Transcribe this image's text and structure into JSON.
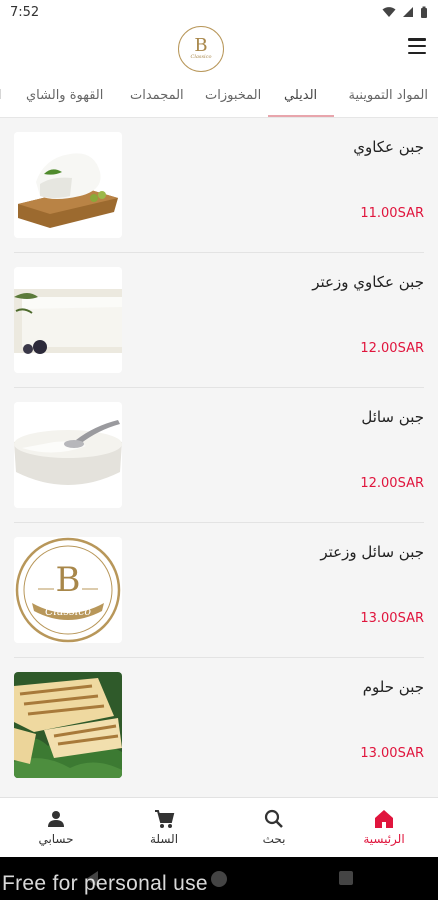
{
  "status_bar": {
    "time": "7:52"
  },
  "header": {
    "logo_main": "B",
    "logo_sub": "Classico"
  },
  "tabs": [
    {
      "label": "المواد التموينية"
    },
    {
      "label": "الديلي"
    },
    {
      "label": "المخبوزات"
    },
    {
      "label": "المجمدات"
    },
    {
      "label": "القهوة والشاي"
    }
  ],
  "active_tab": "الديلي",
  "products": [
    {
      "name": "جبن عكاوي",
      "price": "11.00SAR",
      "image": "akkawi-cheese-board"
    },
    {
      "name": "جبن عكاوي وزعتر",
      "price": "12.00SAR",
      "image": "white-cheese-block"
    },
    {
      "name": "جبن سائل",
      "price": "12.00SAR",
      "image": "cream-cheese-bowl"
    },
    {
      "name": "جبن سائل وزعتر",
      "price": "13.00SAR",
      "image": "bakery-logo-placeholder"
    },
    {
      "name": "جبن حلوم",
      "price": "13.00SAR",
      "image": "grilled-halloumi"
    }
  ],
  "bottom_nav": [
    {
      "label": "حسابي",
      "icon": "person-icon"
    },
    {
      "label": "السلة",
      "icon": "cart-icon"
    },
    {
      "label": "بحث",
      "icon": "search-icon"
    },
    {
      "label": "الرئيسية",
      "icon": "home-icon",
      "active": true
    }
  ],
  "watermark": "Free for personal use",
  "colors": {
    "accent": "#e0153d",
    "tab_underline": "#e8a5ac",
    "logo_gold": "#b8975a"
  }
}
